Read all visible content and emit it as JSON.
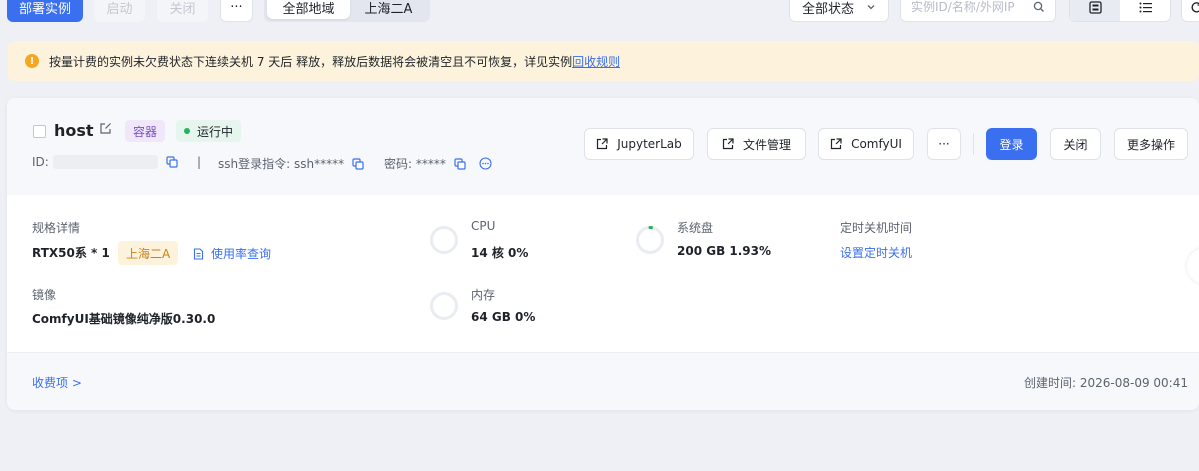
{
  "toolbar": {
    "deploy_label": "部署实例",
    "start_label": "启动",
    "stop_label": "关闭",
    "more_label": "···",
    "region_tabs": [
      {
        "label": "全部地域",
        "active": true
      },
      {
        "label": "上海二A",
        "active": false
      }
    ],
    "status_select": "全部状态",
    "search_placeholder": "实例ID/名称/外网IP",
    "view_modes": [
      "grid",
      "list"
    ],
    "refresh": "refresh"
  },
  "notice": {
    "text": "按量计费的实例未欠费状态下连续关机 7 天后 释放，释放后数据将会被清空且不可恢复，详见实例",
    "link": "回收规则"
  },
  "instance": {
    "name": "host",
    "type_tag": "容器",
    "status": "运行中",
    "id_label": "ID:",
    "ssh_label": "ssh登录指令: ssh*****",
    "password_label": "密码: *****",
    "actions": {
      "jupyter": "JupyterLab",
      "files": "文件管理",
      "comfyui": "ComfyUI",
      "more": "···",
      "login": "登录",
      "shutdown": "关闭",
      "more_ops": "更多操作"
    },
    "spec": {
      "label": "规格详情",
      "value": "RTX50系 * 1",
      "region": "上海二A",
      "usage_link": "使用率查询"
    },
    "cpu": {
      "label": "CPU",
      "value": "14 核 0%",
      "usage": 0
    },
    "disk": {
      "label": "系统盘",
      "value": "200 GB 1.93%",
      "usage": 0.0193
    },
    "schedule": {
      "label": "定时关机时间",
      "link": "设置定时关机"
    },
    "image": {
      "label": "镜像",
      "value": "ComfyUI基础镜像纯净版0.30.0"
    },
    "memory": {
      "label": "内存",
      "value": "64 GB 0%",
      "usage": 0
    },
    "billing_link": "收费项 >",
    "created": "创建时间: 2026-08-09 00:41"
  },
  "colors": {
    "primary": "#3a6ff0",
    "running": "#22b35e",
    "warning": "#f5a623",
    "container_tag": "#7b4fc2"
  }
}
